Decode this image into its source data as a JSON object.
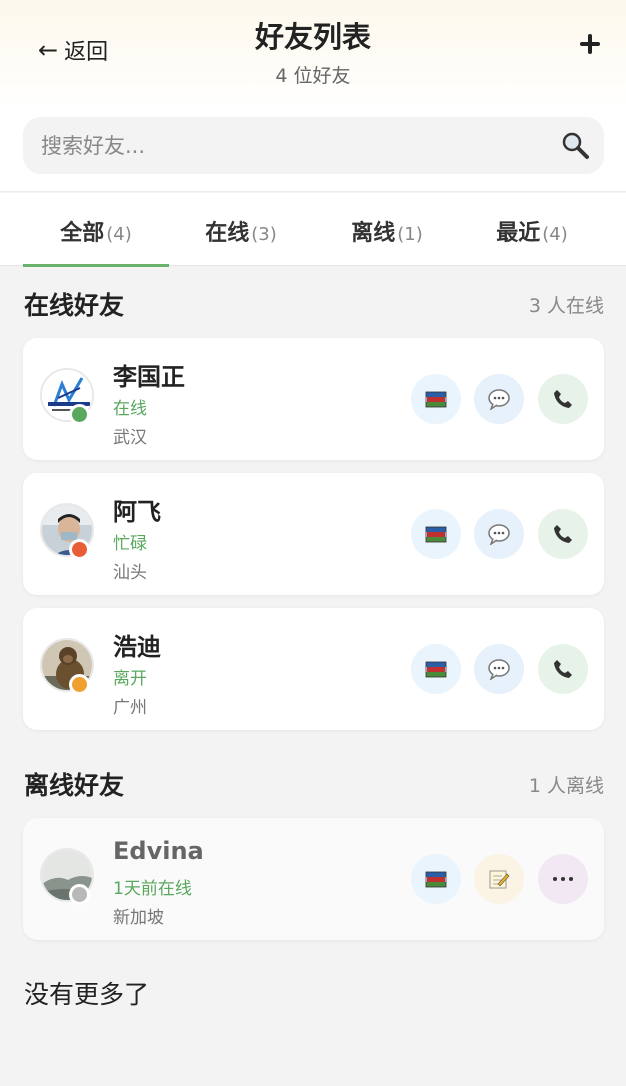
{
  "header": {
    "back_label": "返回",
    "title": "好友列表",
    "subtitle": "4 位好友"
  },
  "search": {
    "placeholder": "搜索好友..."
  },
  "tabs": [
    {
      "label": "全部",
      "count": "(4)",
      "active": true
    },
    {
      "label": "在线",
      "count": "(3)",
      "active": false
    },
    {
      "label": "离线",
      "count": "(1)",
      "active": false
    },
    {
      "label": "最近",
      "count": "(4)",
      "active": false
    }
  ],
  "online_section": {
    "title": "在线好友",
    "count": "3 人在线"
  },
  "offline_section": {
    "title": "离线好友",
    "count": "1 人离线"
  },
  "friends_online": [
    {
      "name": "李国正",
      "status": "在线",
      "location": "武汉",
      "status_color": "#5aa85e"
    },
    {
      "name": "阿飞",
      "status": "忙碌",
      "location": "汕头",
      "status_color": "#e85d35"
    },
    {
      "name": "浩迪",
      "status": "离开",
      "location": "广州",
      "status_color": "#f0a030"
    }
  ],
  "friends_offline": [
    {
      "name": "Edvina",
      "status": "1天前在线",
      "location": "新加坡",
      "status_color": "#b8b8b8"
    }
  ],
  "footer": {
    "text": "没有更多了"
  },
  "colors": {
    "accent": "#6ab16c",
    "online": "#5aa85e"
  }
}
